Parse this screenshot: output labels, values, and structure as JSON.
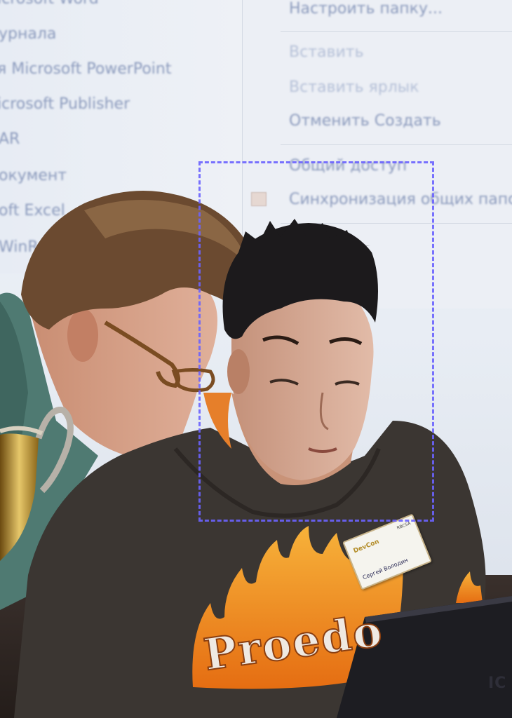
{
  "projection": {
    "left_menu_items": [
      "icrosoft Word",
      "урнала",
      "я Microsoft PowerPoint",
      "icrosoft Publisher",
      "AR",
      "окумент",
      "oft Excel",
      "WinRA"
    ],
    "right_menu_items": [
      "Настроить папку...",
      "Вставить",
      "Вставить ярлык",
      "Отменить Создать",
      "Общий доступ",
      "Синхронизация общих папок"
    ]
  },
  "badge": {
    "event_logo": "DevCon",
    "event_small": "RBCSA",
    "name": "Сергей Володин"
  },
  "sweatshirt_print": "Proedo",
  "laptop_brand": "IC",
  "colors": {
    "selection_box": "#6b63ff",
    "sweatshirt": "#3b3632",
    "flames": "#f08a20"
  }
}
